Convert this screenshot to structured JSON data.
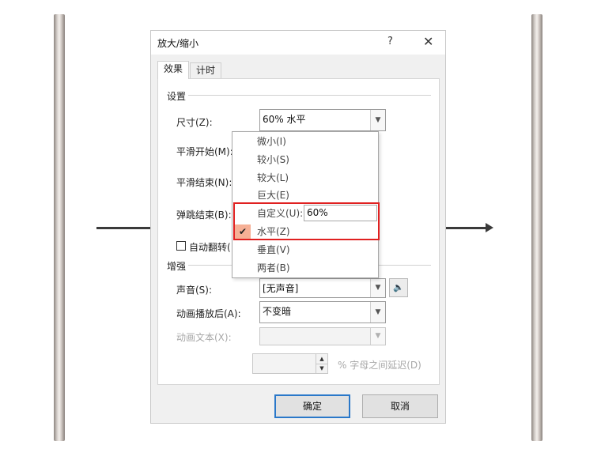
{
  "dialog": {
    "title": "放大/缩小",
    "help": "?",
    "close": "✕"
  },
  "tabs": [
    {
      "label": "效果",
      "active": true
    },
    {
      "label": "计时",
      "active": false
    }
  ],
  "settings": {
    "group_title": "设置",
    "size_label": "尺寸(Z):",
    "size_value": "60% 水平",
    "smooth_start_label": "平滑开始(M):",
    "smooth_end_label": "平滑结束(N):",
    "bounce_end_label": "弹跳结束(B):",
    "auto_reverse_label": "自动翻转(",
    "auto_reverse_checked": false
  },
  "enhance": {
    "group_title": "增强",
    "sound_label": "声音(S):",
    "sound_value": "[无声音]",
    "after_anim_label": "动画播放后(A):",
    "after_anim_value": "不变暗",
    "anim_text_label": "动画文本(X):",
    "anim_text_value": "",
    "delay_value": "",
    "delay_label": "% 字母之间延迟(D)"
  },
  "size_dropdown": {
    "items": [
      {
        "label": "微小(I)",
        "checked": false
      },
      {
        "label": "较小(S)",
        "checked": false
      },
      {
        "label": "较大(L)",
        "checked": false
      },
      {
        "label": "巨大(E)",
        "checked": false
      },
      {
        "label": "自定义(U):",
        "checked": false,
        "input_value": "60%"
      },
      {
        "label": "水平(Z)",
        "checked": true
      },
      {
        "label": "垂直(V)",
        "checked": false
      },
      {
        "label": "两者(B)",
        "checked": false
      }
    ],
    "check_glyph": "✔",
    "highlight_color": "#e02020",
    "check_bg_color": "#f6b096"
  },
  "buttons": {
    "ok": "确定",
    "cancel": "取消"
  },
  "icons": {
    "combo_arrow": "▼",
    "speaker": "🔈",
    "spin_up": "▲",
    "spin_down": "▼"
  }
}
